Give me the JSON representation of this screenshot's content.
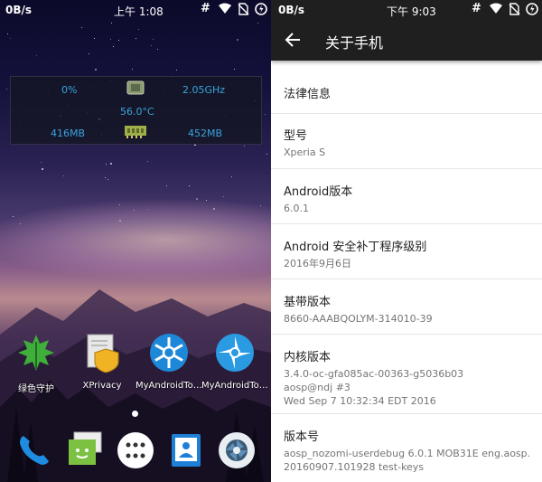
{
  "home": {
    "status_bar": {
      "net_speed": "0B/s",
      "time": "上午 1:08"
    },
    "widget": {
      "cpu_usage": "0%",
      "cpu_freq": "2.05GHz",
      "temperature": "56.0°C",
      "ram_left": "416MB",
      "ram_right": "452MB"
    },
    "apps": [
      {
        "label": "绿色守护",
        "icon": "greenify-leaf-icon"
      },
      {
        "label": "XPrivacy",
        "icon": "xprivacy-shield-icon"
      },
      {
        "label": "MyAndroidTools",
        "icon": "myandroidtools-icon"
      },
      {
        "label": "MyAndroidTools",
        "icon": "myandroidtools-icon"
      }
    ],
    "dock": [
      "phone-icon",
      "messaging-icon",
      "app-drawer-icon",
      "contacts-icon",
      "camera-icon"
    ]
  },
  "settings": {
    "status_bar": {
      "net_speed": "0B/s",
      "time": "下午 9:03"
    },
    "title": "关于手机",
    "items": [
      {
        "title": "法律信息",
        "lines": []
      },
      {
        "title": "型号",
        "lines": [
          "Xperia S"
        ]
      },
      {
        "title": "Android版本",
        "lines": [
          "6.0.1"
        ]
      },
      {
        "title": "Android 安全补丁程序级别",
        "lines": [
          "2016年9月6日"
        ]
      },
      {
        "title": "基带版本",
        "lines": [
          "8660-AAABQOLYM-314010-39"
        ]
      },
      {
        "title": "内核版本",
        "lines": [
          "3.4.0-oc-gfa085ac-00363-g5036b03",
          "aosp@ndj #3",
          "Wed Sep 7 10:32:34 EDT 2016"
        ]
      },
      {
        "title": "版本号",
        "lines": [
          "aosp_nozomi-userdebug 6.0.1 MOB31E eng.aosp.",
          "20160907.101928 test-keys"
        ]
      }
    ]
  },
  "colors": {
    "widget_text": "#39a4dd",
    "appbar": "#1f1f1f"
  }
}
